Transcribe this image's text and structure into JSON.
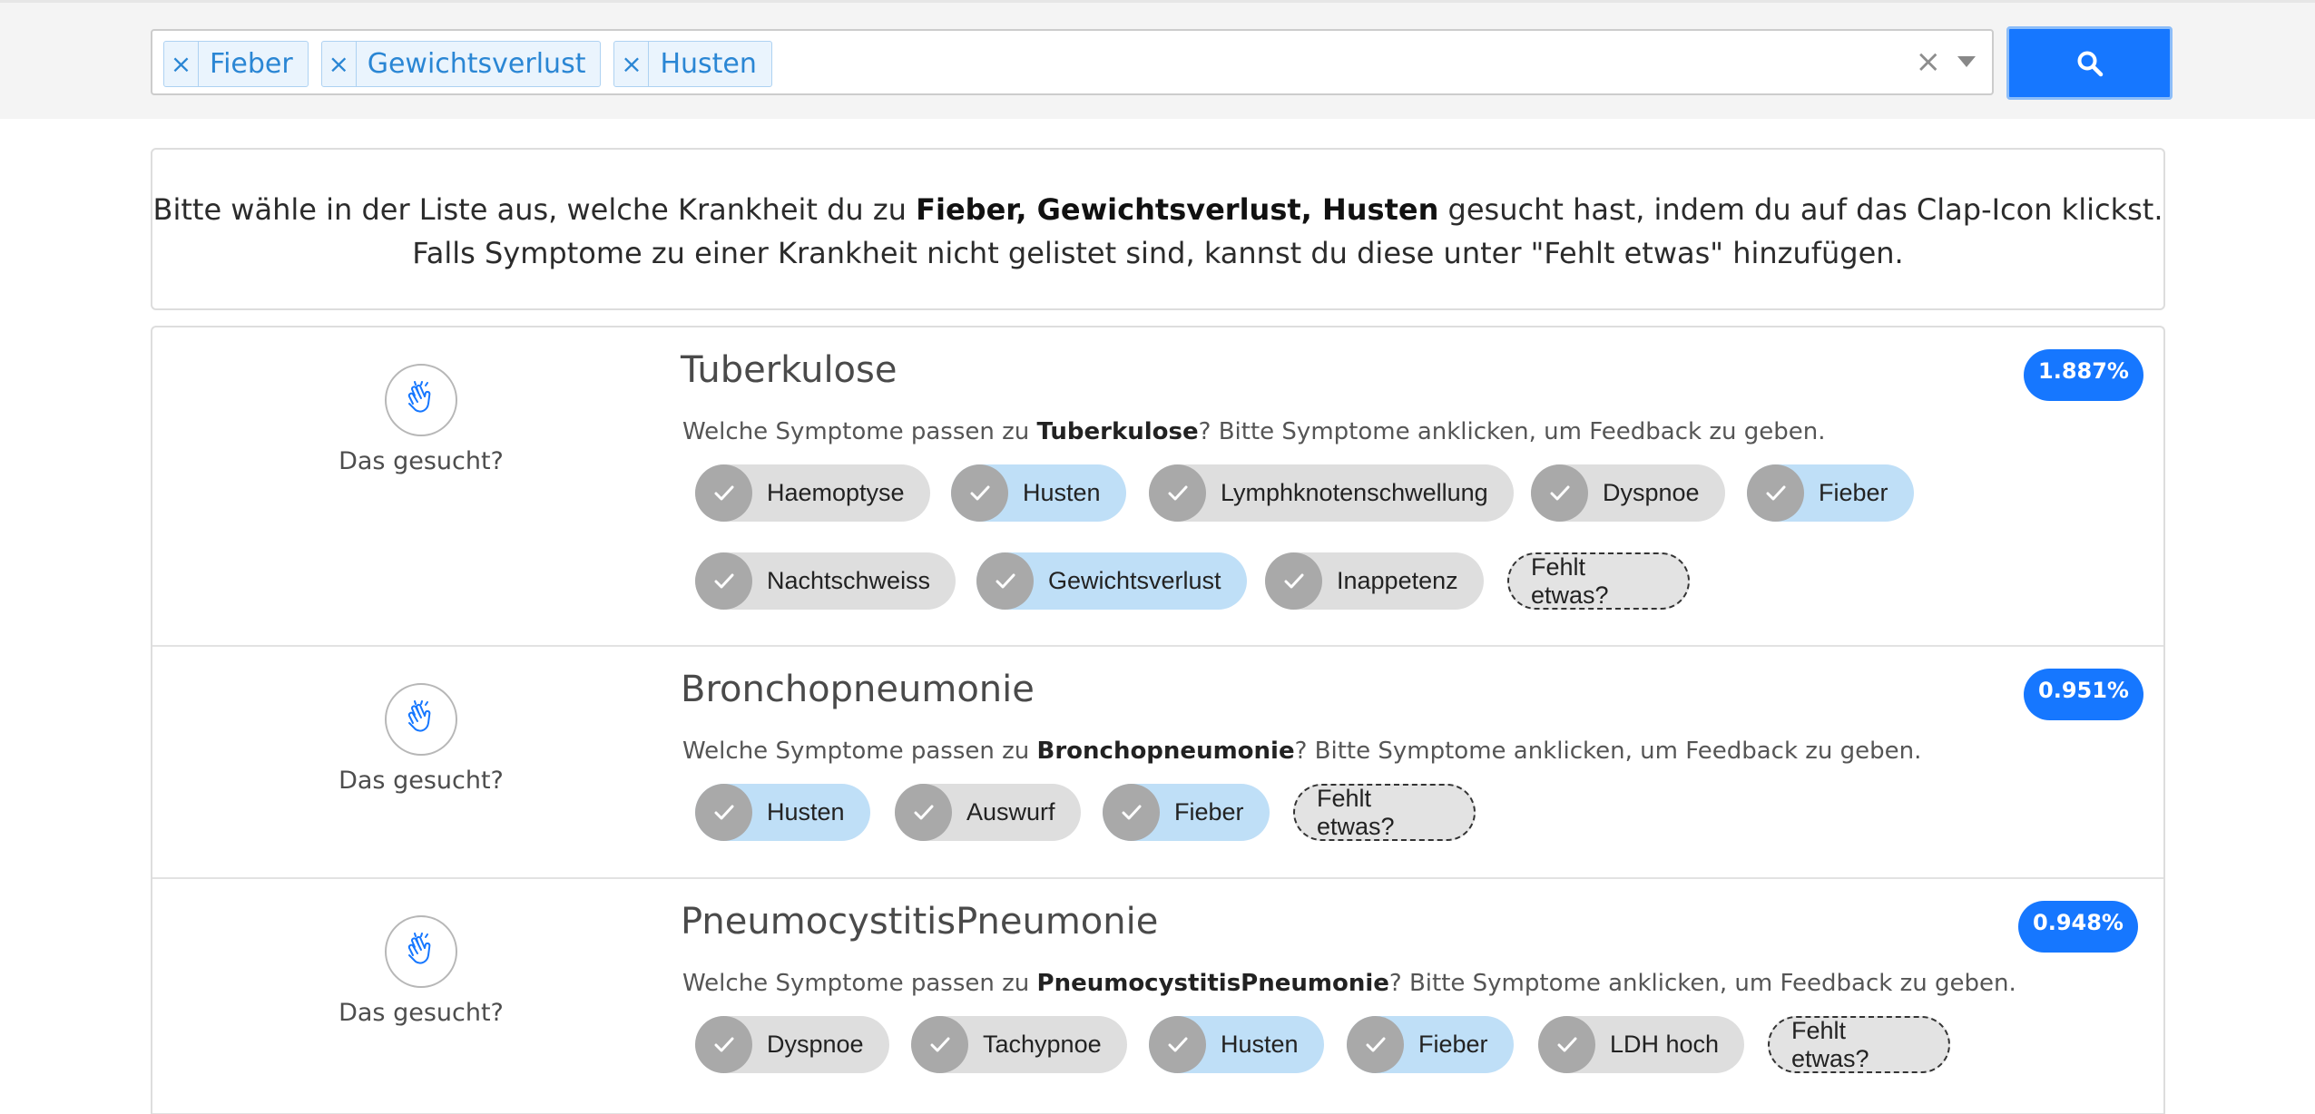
{
  "search": {
    "tags": [
      {
        "remove": "×",
        "label": "Fieber"
      },
      {
        "remove": "×",
        "label": "Gewichtsverlust"
      },
      {
        "remove": "×",
        "label": "Husten"
      }
    ],
    "clear": "×",
    "accent": "#1677ff"
  },
  "info": {
    "line1_pre": "Bitte wähle in der Liste aus, welche Krankheit du zu ",
    "line1_bold": "Fieber, Gewichtsverlust, Husten",
    "line1_post": " gesucht hast, indem du auf das Clap-Icon klickst.",
    "line2": "Falls Symptome zu einer Krankheit nicht gelistet sind, kannst du diese unter \"Fehlt etwas\" hinzufügen."
  },
  "results": [
    {
      "clap_label": "Das gesucht?",
      "title": "Tuberkulose",
      "score": "1.887%",
      "prompt_pre": "Welche Symptome passen zu ",
      "prompt_bold": "Tuberkulose",
      "prompt_post": "? Bitte Symptome anklicken, um Feedback zu geben.",
      "symptoms": [
        {
          "label": "Haemoptyse",
          "matched": false
        },
        {
          "label": "Husten",
          "matched": true
        },
        {
          "label": "Lymphknotenschwellung",
          "matched": false
        },
        {
          "label": "Dyspnoe",
          "matched": false
        },
        {
          "label": "Fieber",
          "matched": true
        },
        {
          "label": "Nachtschweiss",
          "matched": false
        },
        {
          "label": "Gewichtsverlust",
          "matched": true
        },
        {
          "label": "Inappetenz",
          "matched": false
        }
      ],
      "missing_label": "Fehlt etwas?"
    },
    {
      "clap_label": "Das gesucht?",
      "title": "Bronchopneumonie",
      "score": "0.951%",
      "prompt_pre": "Welche Symptome passen zu ",
      "prompt_bold": "Bronchopneumonie",
      "prompt_post": "? Bitte Symptome anklicken, um Feedback zu geben.",
      "symptoms": [
        {
          "label": "Husten",
          "matched": true
        },
        {
          "label": "Auswurf",
          "matched": false
        },
        {
          "label": "Fieber",
          "matched": true
        }
      ],
      "missing_label": "Fehlt etwas?"
    },
    {
      "clap_label": "Das gesucht?",
      "title": "PneumocystitisPneumonie",
      "score": "0.948%",
      "prompt_pre": "Welche Symptome passen zu ",
      "prompt_bold": "PneumocystitisPneumonie",
      "prompt_post": "? Bitte Symptome anklicken, um Feedback zu geben.",
      "symptoms": [
        {
          "label": "Dyspnoe",
          "matched": false
        },
        {
          "label": "Tachypnoe",
          "matched": false
        },
        {
          "label": "Husten",
          "matched": true
        },
        {
          "label": "Fieber",
          "matched": true
        },
        {
          "label": "LDH hoch",
          "matched": false
        }
      ],
      "missing_label": "Fehlt etwas?"
    }
  ]
}
